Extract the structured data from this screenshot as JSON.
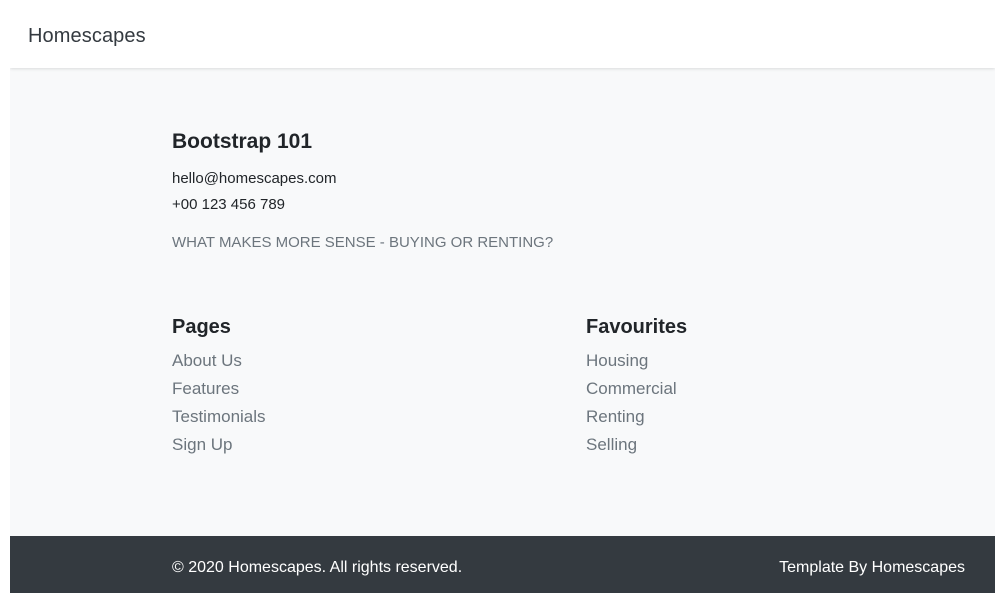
{
  "navbar": {
    "brand": "Homescapes"
  },
  "contact": {
    "title": "Bootstrap 101",
    "email": "hello@homescapes.com",
    "phone": "+00 123 456 789",
    "tagline": "WHAT MAKES MORE SENSE - BUYING OR RENTING?"
  },
  "pages": {
    "title": "Pages",
    "links": [
      "About Us",
      "Features",
      "Testimonials",
      "Sign Up"
    ]
  },
  "favourites": {
    "title": "Favourites",
    "links": [
      "Housing",
      "Commercial",
      "Renting",
      "Selling"
    ]
  },
  "footer": {
    "copyright": "© 2020 Homescapes. All rights reserved.",
    "template_by": "Template By Homescapes"
  },
  "colors": {
    "navbar_bg": "#ffffff",
    "page_bg": "#f8f9fa",
    "footer_bg": "#343a40",
    "muted_text": "#6c757d",
    "heading_text": "#212529"
  }
}
